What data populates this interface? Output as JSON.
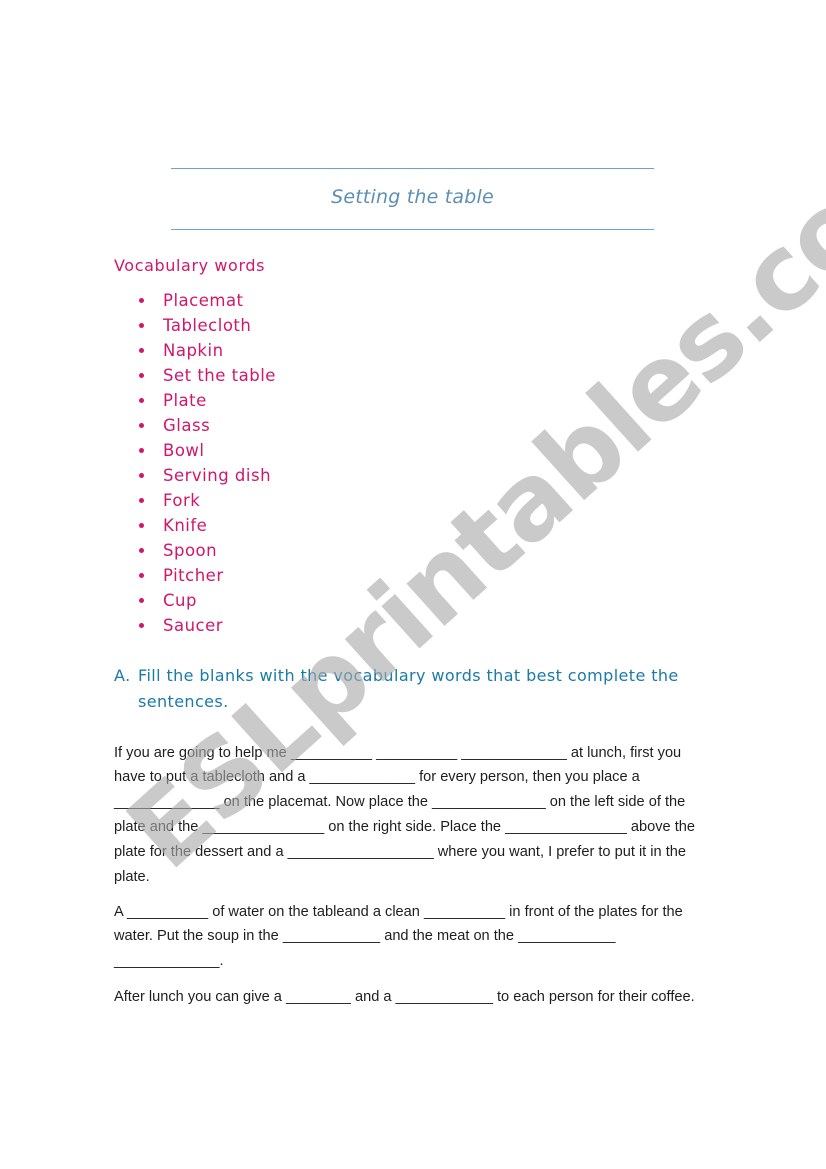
{
  "document": {
    "title": "Setting the table",
    "vocabulary": {
      "heading": "Vocabulary words",
      "items": [
        "Placemat",
        "Tablecloth",
        "Napkin",
        "Set the table",
        "Plate",
        "Glass",
        "Bowl",
        "Serving dish",
        "Fork",
        "Knife",
        "Spoon",
        "Pitcher",
        "Cup",
        "Saucer"
      ]
    },
    "exercise": {
      "letter": "A.",
      "instruction": "Fill the blanks with the vocabulary words that best complete the sentences."
    },
    "paragraphs": [
      "If you are going to help me __________ __________ _____________ at lunch, first you have to put a tablecloth and a _____________ for every person, then you place a _____________ on the placemat. Now place the ______________ on the left side of the plate and the _______________ on the right side.  Place the _______________ above the plate for the dessert and a __________________ where you want, I prefer to put it in the plate.",
      "A __________ of water on the tableand a clean __________ in front of the plates for the water. Put the soup in the ____________ and the meat on the ____________ _____________.",
      "After lunch you can give a ________ and a ____________ to each person for their coffee."
    ],
    "watermark": "ESLprintables.com"
  },
  "colors": {
    "title": "#5b8fb5",
    "rule": "#6fa3c9",
    "vocabulary": "#d1176a",
    "exercise": "#1a7aa8",
    "body_text": "#1e1e1e",
    "watermark": "#aaaaaa"
  }
}
